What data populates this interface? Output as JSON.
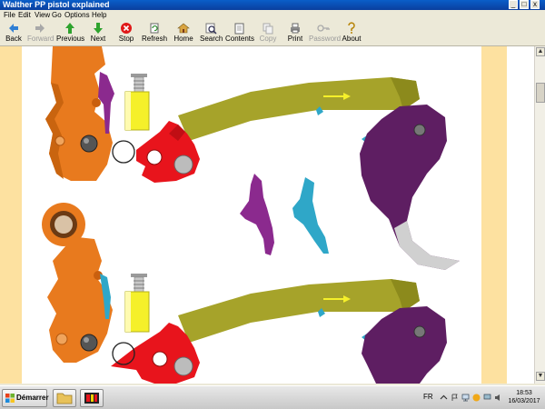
{
  "window": {
    "title": "Walther PP pistol explained",
    "controls": {
      "minimize": "_",
      "maximize": "□",
      "close": "x"
    }
  },
  "menu": [
    "File",
    "Edit",
    "View",
    "Go",
    "Options",
    "Help"
  ],
  "toolbar": [
    {
      "label": "Back",
      "icon": "back-arrow-icon",
      "enabled": true
    },
    {
      "label": "Forward",
      "icon": "forward-arrow-icon",
      "enabled": false
    },
    {
      "label": "Previous",
      "icon": "up-arrow-icon",
      "enabled": true
    },
    {
      "label": "Next",
      "icon": "down-arrow-icon",
      "enabled": true
    },
    {
      "label": "Stop",
      "icon": "stop-icon",
      "enabled": true
    },
    {
      "label": "Refresh",
      "icon": "refresh-icon",
      "enabled": true
    },
    {
      "label": "Home",
      "icon": "home-icon",
      "enabled": true
    },
    {
      "label": "Search",
      "icon": "search-icon",
      "enabled": true
    },
    {
      "label": "Contents",
      "icon": "contents-icon",
      "enabled": true
    },
    {
      "label": "Copy",
      "icon": "copy-icon",
      "enabled": false
    },
    {
      "label": "Print",
      "icon": "print-icon",
      "enabled": true
    },
    {
      "label": "Password",
      "icon": "key-icon",
      "enabled": false
    },
    {
      "label": "About",
      "icon": "about-icon",
      "enabled": true
    }
  ],
  "diagram": {
    "colors": {
      "frame": "#e87a1e",
      "trigger_bar": "#a6a32a",
      "hammer": "#e8141c",
      "spring_guide": "#f5f02a",
      "sear_purple": "#8b2a8e",
      "ejector_blue": "#2fa7c8",
      "trigger": "#5e1e62",
      "side_band": "#fde1a0"
    }
  },
  "taskbar": {
    "start_label": "Démarrer",
    "language": "FR",
    "time": "18:53",
    "date": "16/03/2017"
  }
}
